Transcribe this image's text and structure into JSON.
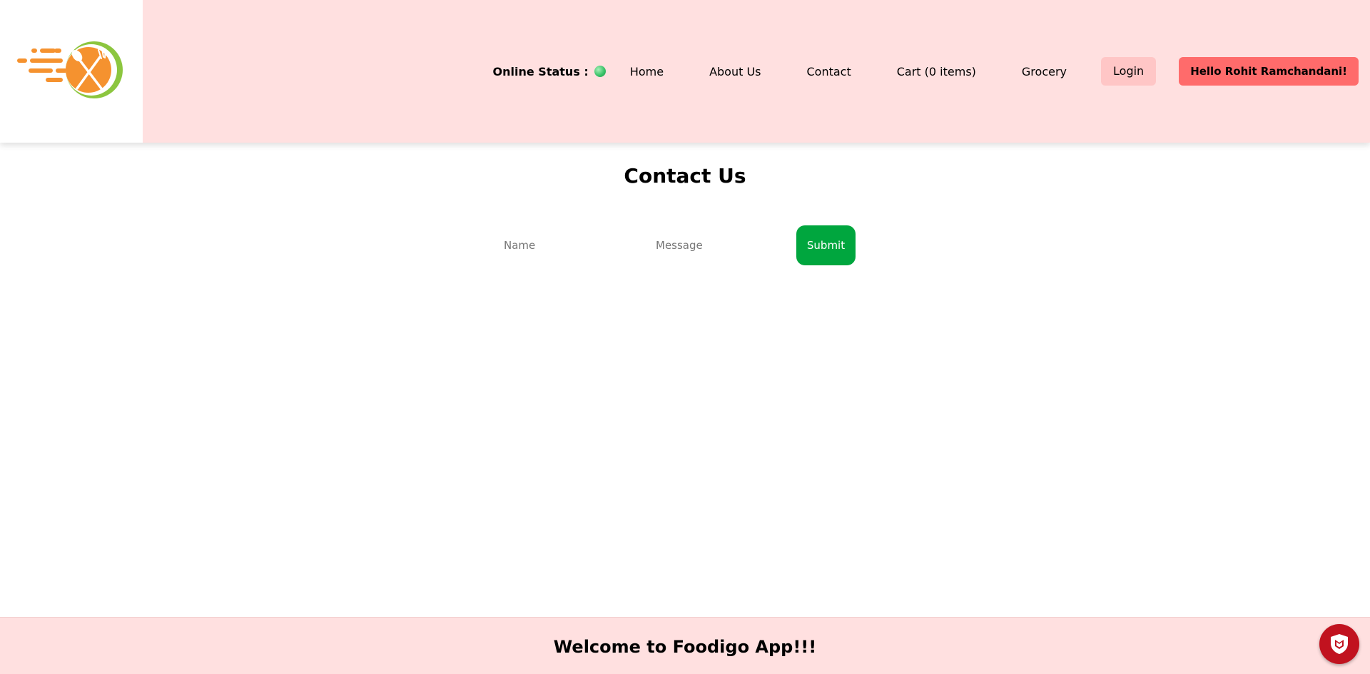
{
  "header": {
    "logo": {
      "icon": "food-delivery-logo",
      "colors": {
        "orange": "#f5922f",
        "green": "#8cc63f"
      }
    },
    "online_status": {
      "label": "Online Status :",
      "state": "online",
      "color": "#3cc36a"
    },
    "nav": {
      "home": "Home",
      "about": "About Us",
      "contact": "Contact",
      "cart": "Cart (0 items)",
      "grocery": "Grocery"
    },
    "login_label": "Login",
    "user_greeting": "Hello Rohit Ramchandani!"
  },
  "main": {
    "title": "Contact Us",
    "form": {
      "name_placeholder": "Name",
      "name_value": "",
      "message_placeholder": "Message",
      "message_value": "",
      "submit_label": "Submit"
    }
  },
  "footer": {
    "text": "Welcome to Foodigo App!!!"
  },
  "extension_badge": {
    "icon": "shield-icon",
    "color": "#c1121f"
  },
  "colors": {
    "header_bg": "#ffe0e0",
    "login_bg": "#ffc6c6",
    "user_btn_bg": "#ff6b6b",
    "submit_bg": "#00a63e"
  }
}
